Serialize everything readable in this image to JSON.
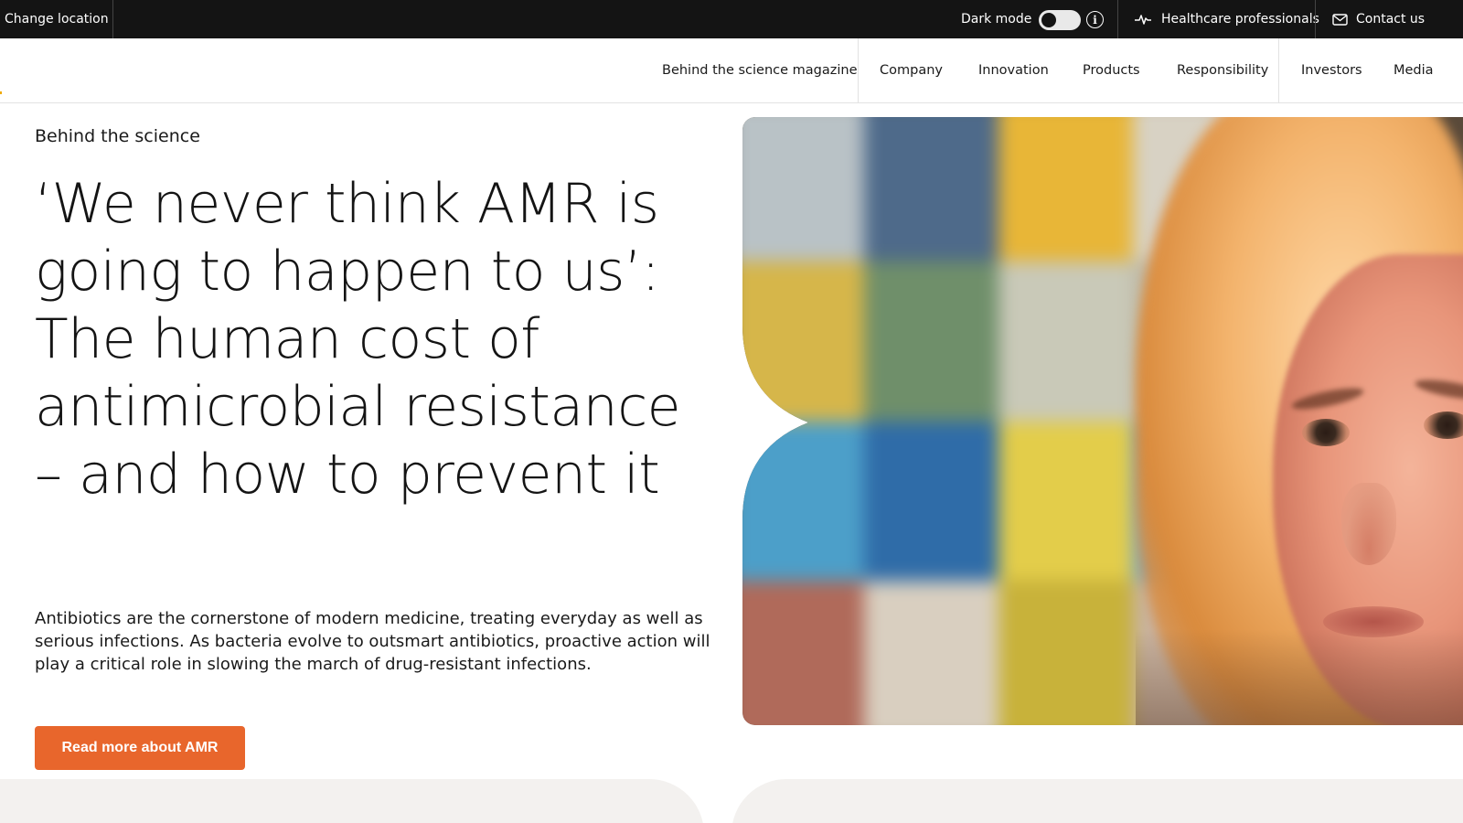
{
  "topbar": {
    "change_location": "Change location",
    "dark_mode_label": "Dark mode",
    "dark_mode_on": false,
    "info_glyph": "i",
    "healthcare_professionals": "Healthcare professionals",
    "contact_us": "Contact us",
    "icons": [
      "info-icon",
      "pulse-icon",
      "mail-icon"
    ]
  },
  "nav": {
    "items": [
      "Behind the science magazine",
      "Company",
      "Innovation",
      "Products",
      "Responsibility",
      "Investors",
      "Media"
    ]
  },
  "hero": {
    "eyebrow": "Behind the science",
    "headline": "‘We never think AMR is going to happen to us’: The human cost of antimicrobial resistance – and how to prevent it",
    "lede": "Antibiotics are the cornerstone of modern medicine, treating everyday as well as serious infections. As bacteria evolve to outsmart antibiotics, proactive action will play a critical role in slowing the march of drug-resistant infections.",
    "cta_label": "Read more about AMR"
  },
  "colors": {
    "topbar_bg": "#141414",
    "accent_orange": "#e8662c",
    "text": "#141414",
    "panel_bg": "#f3f1ef"
  }
}
